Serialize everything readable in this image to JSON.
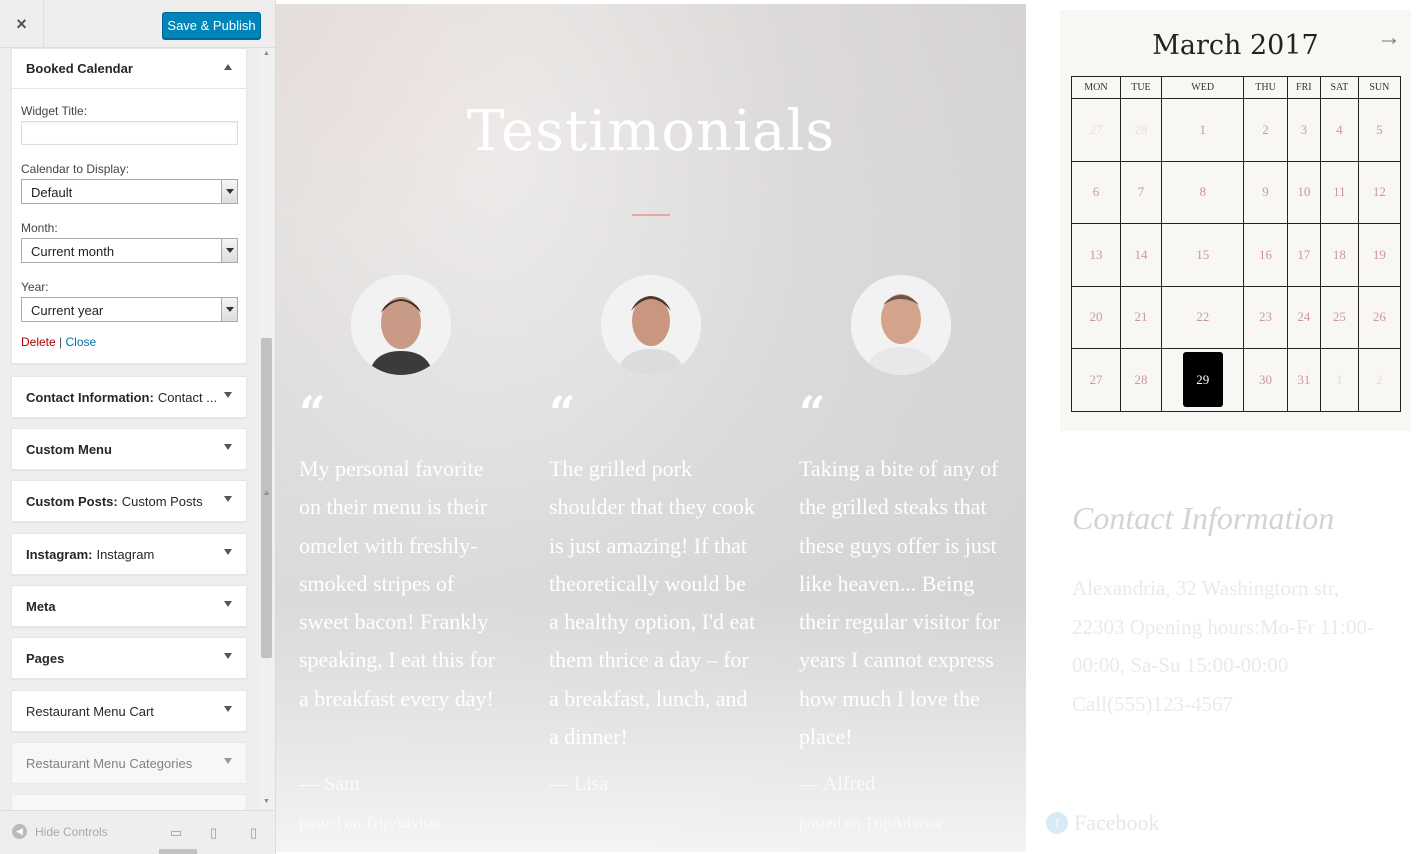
{
  "sidebar": {
    "close_icon": "×",
    "publish_label": "Save & Publish",
    "booked": {
      "title": "Booked Calendar",
      "widget_title_label": "Widget Title:",
      "widget_title_value": "",
      "calendar_label": "Calendar to Display:",
      "calendar_value": "Default",
      "month_label": "Month:",
      "month_value": "Current month",
      "year_label": "Year:",
      "year_value": "Current year",
      "delete_label": "Delete",
      "separator": " | ",
      "close_label": "Close"
    },
    "widgets": [
      {
        "name": "Contact Information:",
        "sub": "Contact ..."
      },
      {
        "name": "Custom Menu",
        "sub": ""
      },
      {
        "name": "Custom Posts:",
        "sub": "Custom Posts"
      },
      {
        "name": "Instagram:",
        "sub": "Instagram"
      },
      {
        "name": "Meta",
        "sub": ""
      },
      {
        "name": "Pages",
        "sub": ""
      },
      {
        "name": "Restaurant Menu Cart",
        "sub": ""
      },
      {
        "name": "Restaurant Menu Categories",
        "sub": ""
      }
    ],
    "hide_controls": "Hide Controls"
  },
  "testimonials": {
    "title": "Testimonials",
    "quote_mark": "“",
    "items": [
      {
        "text": "My personal favorite on their menu is their omelet with freshly-smoked stripes of sweet bacon! Frankly speaking, I eat this for a breakfast every day!",
        "author": "— Sam",
        "source": "posted on TripAdvisor"
      },
      {
        "text": "The grilled pork shoulder that they cook is just amazing! If that theoretically would be a healthy option, I'd eat them thrice a day – for a breakfast, lunch, and a dinner!",
        "author": "— Lisa",
        "source": ""
      },
      {
        "text": "Taking a bite of any of the grilled steaks that these guys offer is just like heaven... Being their regular visitor for years I cannot express how much I love the place!",
        "author": "— Alfred",
        "source": "posted on TripAdvisor"
      }
    ]
  },
  "calendar": {
    "title": "March 2017",
    "next_icon": "→",
    "days": [
      "MON",
      "TUE",
      "WED",
      "THU",
      "FRI",
      "SAT",
      "SUN"
    ],
    "weeks": [
      [
        "27",
        "28",
        "1",
        "2",
        "3",
        "4",
        "5"
      ],
      [
        "6",
        "7",
        "8",
        "9",
        "10",
        "11",
        "12"
      ],
      [
        "13",
        "14",
        "15",
        "16",
        "17",
        "18",
        "19"
      ],
      [
        "20",
        "21",
        "22",
        "23",
        "24",
        "25",
        "26"
      ],
      [
        "27",
        "28",
        "29",
        "30",
        "31",
        "1",
        "2"
      ]
    ],
    "today": "29"
  },
  "contact": {
    "title": "Contact Information",
    "text": "Alexandria, 32 Washingtorn str, 22303 Opening hours:Mo-Fr 11:00-00:00, Sa-Su 15:00-00:00 Call(555)123-4567"
  },
  "social": {
    "facebook_label": "Facebook"
  },
  "colors": {
    "publish_button": "#0085ba",
    "delete_link": "#aa0000",
    "close_link": "#0073aa",
    "today_cell": "#000000"
  }
}
